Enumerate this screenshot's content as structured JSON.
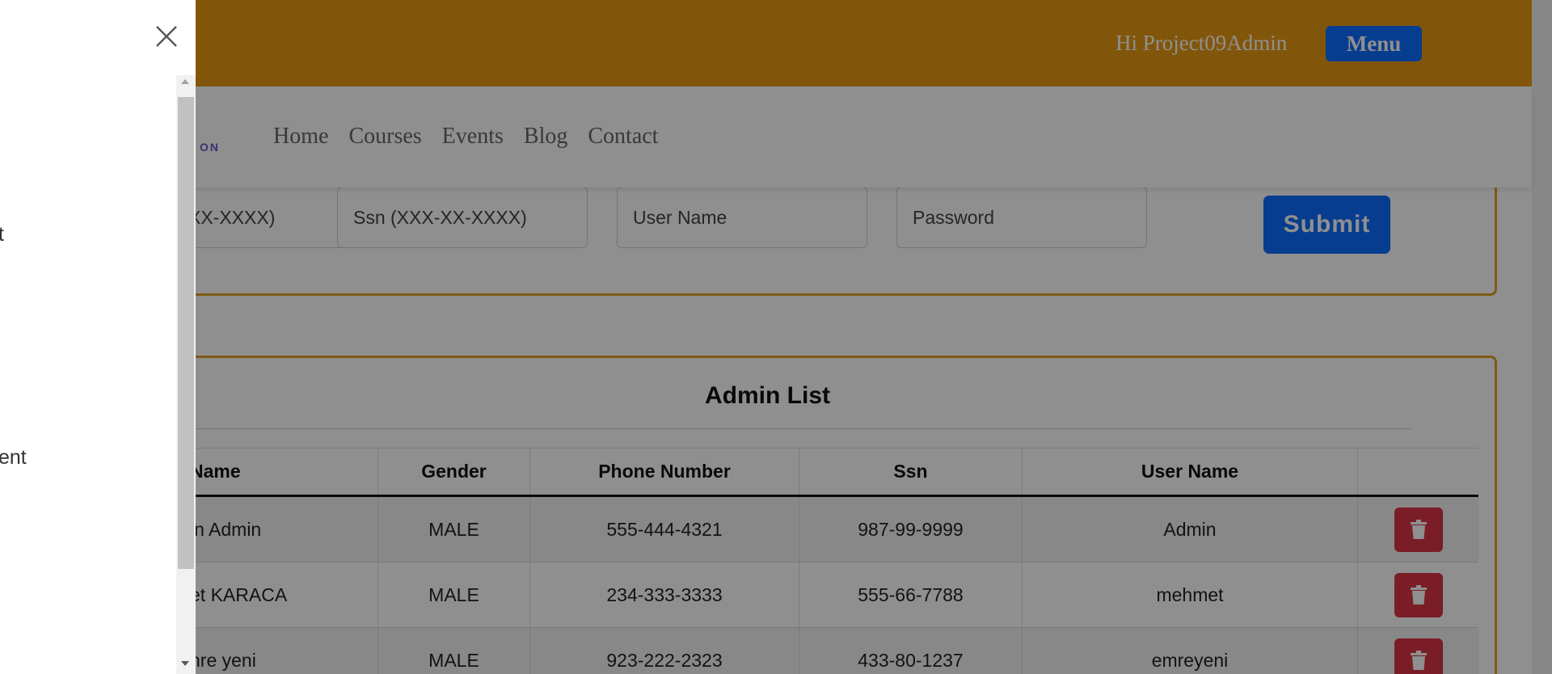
{
  "header": {
    "greeting": "Hi Project09Admin",
    "menu_label": "Menu"
  },
  "navbar": {
    "brand_fragment": "ON",
    "links": [
      "Home",
      "Courses",
      "Events",
      "Blog",
      "Contact"
    ]
  },
  "form": {
    "phone_placeholder_visible": "XX-XXXX)",
    "ssn_placeholder": "Ssn (XXX-XX-XXXX)",
    "username_placeholder": "User Name",
    "password_placeholder": "Password",
    "submit_label": "Submit"
  },
  "admin_list": {
    "title": "Admin List",
    "columns": [
      "Name",
      "Gender",
      "Phone Number",
      "Ssn",
      "User Name",
      ""
    ],
    "rows": [
      {
        "name": "in Admin",
        "gender": "MALE",
        "phone": "555-444-4321",
        "ssn": "987-99-9999",
        "username": "Admin"
      },
      {
        "name": "et KARACA",
        "gender": "MALE",
        "phone": "234-333-3333",
        "ssn": "555-66-7788",
        "username": "mehmet"
      },
      {
        "name": "nre yeni",
        "gender": "MALE",
        "phone": "923-222-2323",
        "ssn": "433-80-1237",
        "username": "emreyeni"
      }
    ]
  },
  "drawer": {
    "items": [
      "t",
      "ent"
    ]
  },
  "colors": {
    "header_bg": "#e89a13",
    "primary_button": "#0d6efd",
    "danger_button": "#dc3545",
    "card_border": "#e0a024"
  },
  "icons": {
    "close": "close-icon",
    "delete": "trash-icon"
  }
}
